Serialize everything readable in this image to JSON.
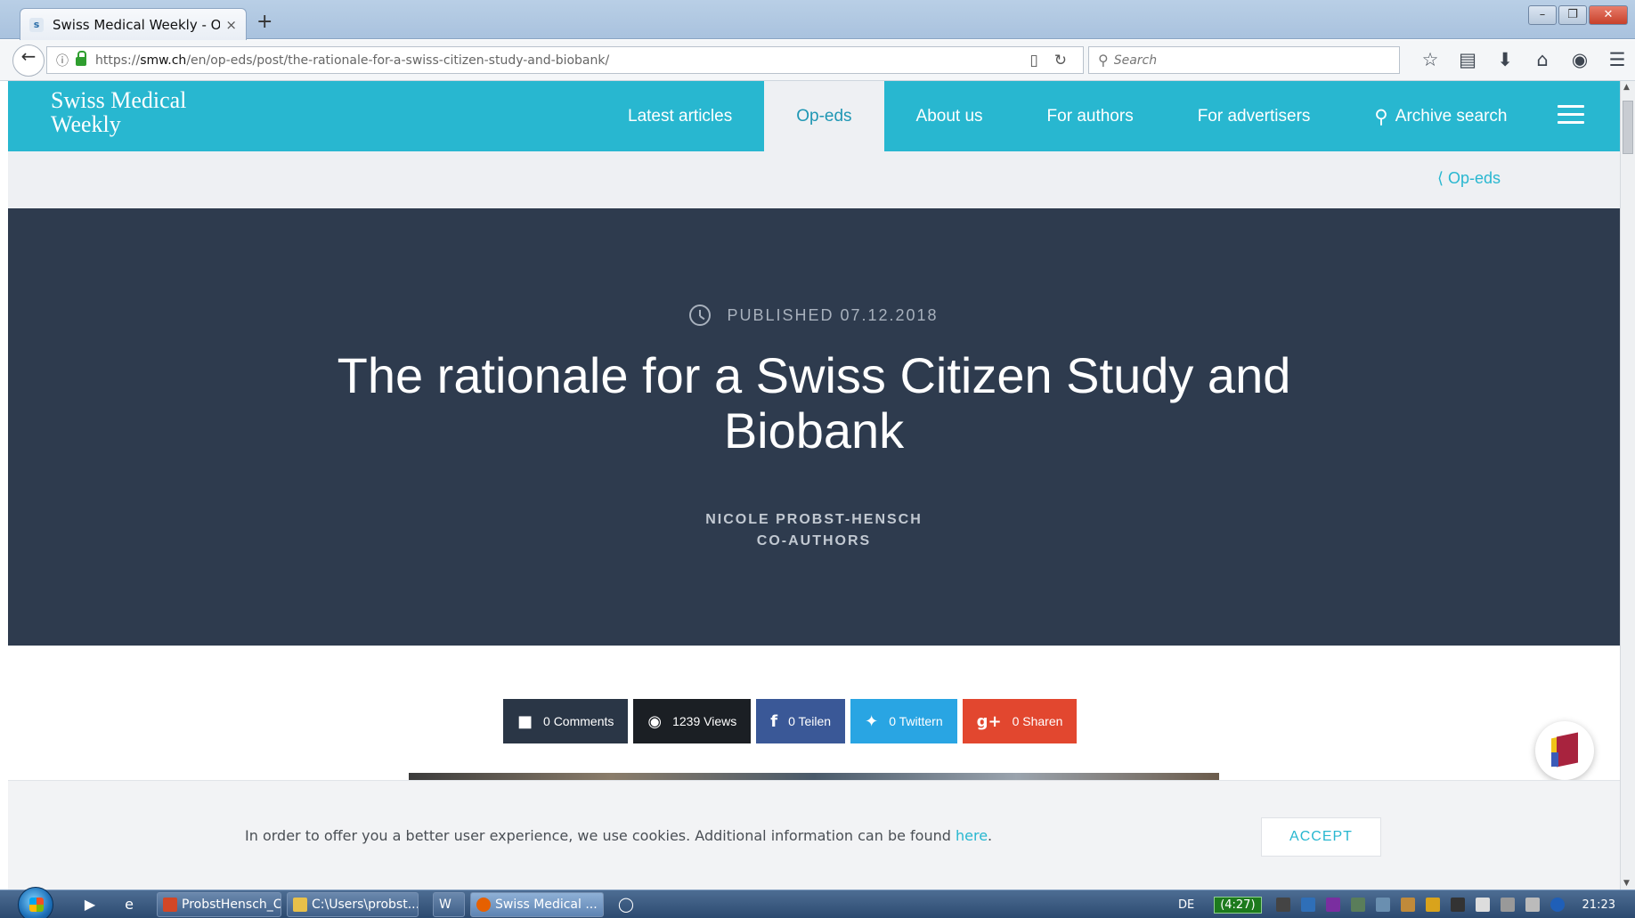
{
  "browser": {
    "tab_favicon": "s",
    "tab_title": "Swiss Medical Weekly - Op...",
    "tab_close": "×",
    "new_tab": "+",
    "url_scheme": "https://",
    "url_host": "smw.ch",
    "url_path": "/en/op-eds/post/the-rationale-for-a-swiss-citizen-study-and-biobank/",
    "search_placeholder": "Search",
    "window_buttons": [
      "–",
      "❐",
      "✕"
    ]
  },
  "site": {
    "logo_line1": "Swiss Medical",
    "logo_line2": "Weekly",
    "nav": [
      {
        "label": "Latest articles"
      },
      {
        "label": "Op-eds"
      },
      {
        "label": "About us"
      },
      {
        "label": "For authors"
      },
      {
        "label": "For advertisers"
      },
      {
        "label": "Archive search"
      }
    ],
    "active_nav": "Op-eds",
    "accent_color": "#28b7d0",
    "breadcrumb": "⟨ Op-eds"
  },
  "article": {
    "published": "PUBLISHED 07.12.2018",
    "title": "The rationale for a Swiss Citizen Study and Biobank",
    "author": "NICOLE PROBST-HENSCH",
    "coauthors": "CO-AUTHORS",
    "hero_color": "#2e3b4e"
  },
  "social": {
    "comments": "0 Comments",
    "views": "1239 Views",
    "facebook": "0 Teilen",
    "twitter": "0 Twittern",
    "gplus": "0 Sharen"
  },
  "cookie": {
    "text": "In order to offer you a better user experience, we use cookies. Additional information can be found ",
    "link": "here",
    "period": ".",
    "accept": "ACCEPT"
  },
  "taskbar": {
    "items": [
      {
        "label": "ProbstHensch_C..."
      },
      {
        "label": "C:\\Users\\probst..."
      },
      {
        "label": "W"
      },
      {
        "label": "Swiss Medical ..."
      }
    ],
    "language": "DE",
    "battery": "(4:27)",
    "time": "21:23"
  }
}
